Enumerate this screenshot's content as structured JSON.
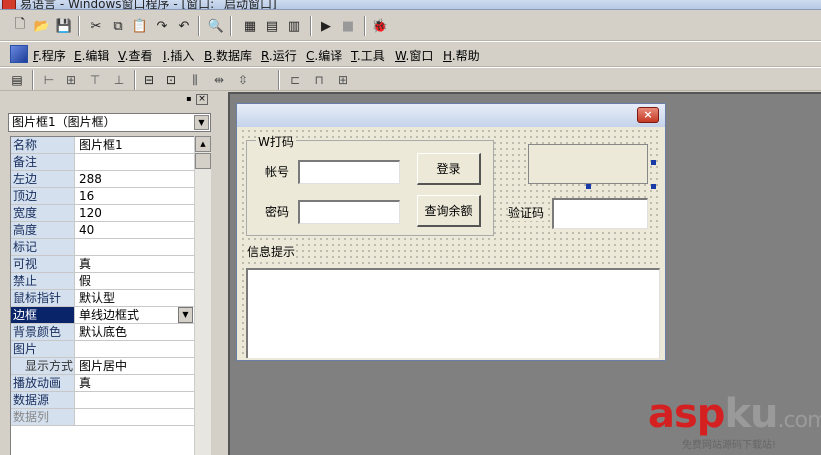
{
  "window": {
    "title": "易语言 - Windows窗口程序 - [窗口: _启动窗口]"
  },
  "toolbar1": {
    "buttons": [
      {
        "icon": "new-file-icon",
        "glyph": "🗋"
      },
      {
        "icon": "open-folder-icon",
        "glyph": "📂"
      },
      {
        "icon": "save-icon",
        "glyph": "💾"
      },
      {
        "icon": "cut-icon",
        "glyph": "✂"
      },
      {
        "icon": "copy-icon",
        "glyph": "⧉"
      },
      {
        "icon": "paste-icon",
        "glyph": "📋"
      },
      {
        "icon": "redo-icon",
        "glyph": "↷"
      },
      {
        "icon": "undo-icon",
        "glyph": "↶"
      },
      {
        "icon": "find-icon",
        "glyph": "🔍"
      },
      {
        "icon": "layout-1-icon",
        "glyph": "▦"
      },
      {
        "icon": "layout-2-icon",
        "glyph": "▤"
      },
      {
        "icon": "layout-3-icon",
        "glyph": "▥"
      },
      {
        "icon": "run-icon",
        "glyph": "▶"
      },
      {
        "icon": "stop-icon",
        "glyph": "■"
      },
      {
        "icon": "debug-icon",
        "glyph": "🐞"
      }
    ]
  },
  "menu": {
    "items": [
      {
        "key": "F",
        "label": ".程序"
      },
      {
        "key": "E",
        "label": ".编辑"
      },
      {
        "key": "V",
        "label": ".查看"
      },
      {
        "key": "I",
        "label": ".插入"
      },
      {
        "key": "B",
        "label": ".数据库"
      },
      {
        "key": "R",
        "label": ".运行"
      },
      {
        "key": "C",
        "label": ".编译"
      },
      {
        "key": "T",
        "label": ".工具"
      },
      {
        "key": "W",
        "label": ".窗口"
      },
      {
        "key": "H",
        "label": ".帮助"
      }
    ]
  },
  "property_panel": {
    "pin_glyph": "▪",
    "close_glyph": "×",
    "selected_object": "图片框1（图片框）",
    "rows": [
      {
        "name": "名称",
        "value": "图片框1"
      },
      {
        "name": "备注",
        "value": ""
      },
      {
        "name": "左边",
        "value": "288"
      },
      {
        "name": "顶边",
        "value": "16"
      },
      {
        "name": "宽度",
        "value": "120"
      },
      {
        "name": "高度",
        "value": "40"
      },
      {
        "name": "标记",
        "value": ""
      },
      {
        "name": "可视",
        "value": "真"
      },
      {
        "name": "禁止",
        "value": "假"
      },
      {
        "name": "鼠标指针",
        "value": "默认型"
      },
      {
        "name": "边框",
        "value": "单线边框式"
      },
      {
        "name": "背景颜色",
        "value": "默认底色"
      },
      {
        "name": "图片",
        "value": ""
      },
      {
        "name": "显示方式",
        "value": "图片居中"
      },
      {
        "name": "播放动画",
        "value": "真"
      },
      {
        "name": "数据源",
        "value": ""
      },
      {
        "name": "数据列",
        "value": ""
      }
    ]
  },
  "form": {
    "close_glyph": "×",
    "group_title": "W打码",
    "account_label": "帐号",
    "password_label": "密码",
    "login_button": "登录",
    "balance_button": "查询余额",
    "captcha_label": "验证码",
    "info_label": "信息提示"
  },
  "watermark": {
    "part1": "asp",
    "part2": "ku",
    "suffix": ".com",
    "subtitle": "免费网站源码下载站!"
  },
  "colors": {
    "selection": "#0a246a",
    "prop_name_bg": "#d4e0ee",
    "watermark_red": "#d42020"
  }
}
